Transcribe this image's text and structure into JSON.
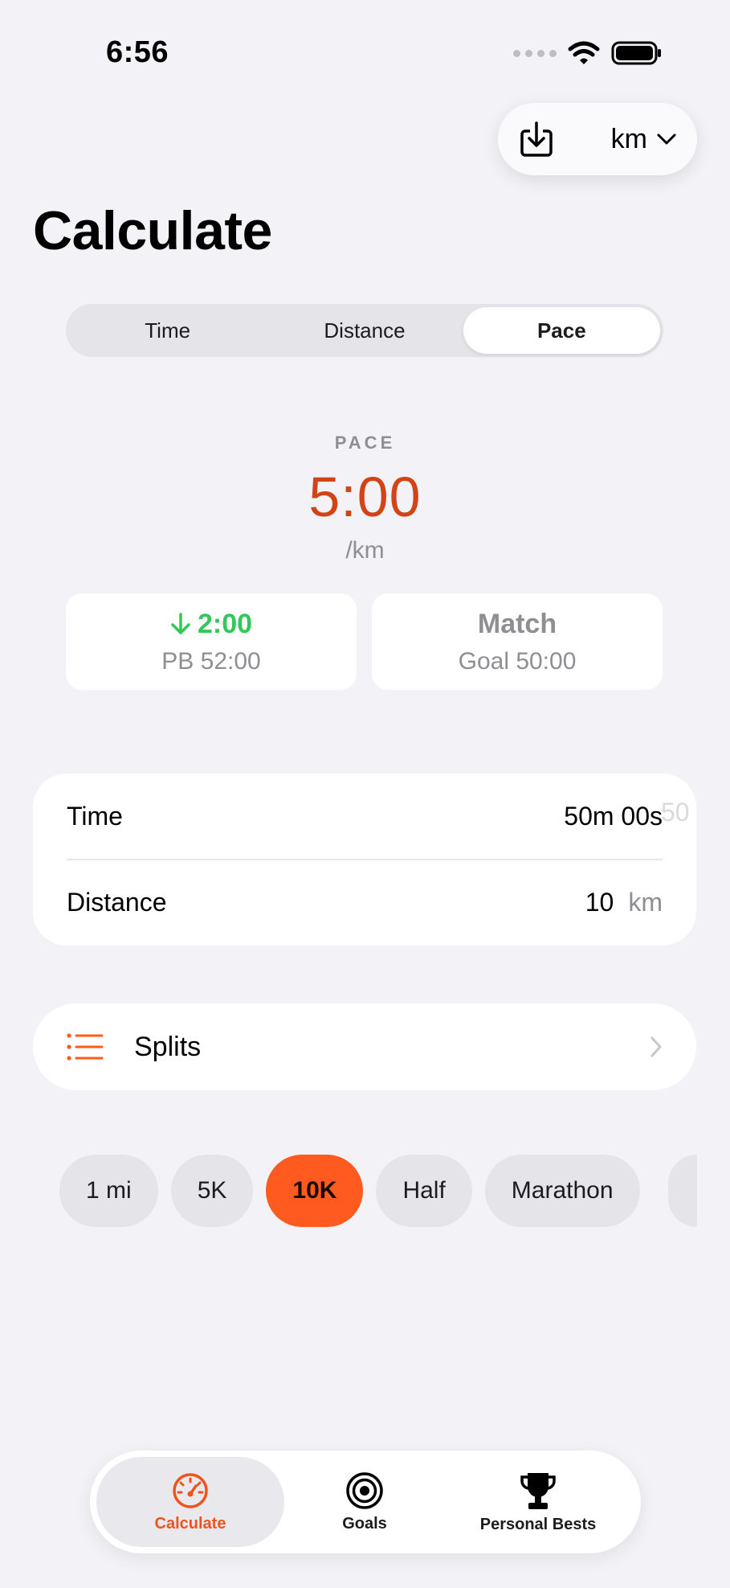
{
  "status_bar": {
    "time": "6:56"
  },
  "toolbar": {
    "unit": "km"
  },
  "page": {
    "title": "Calculate"
  },
  "segments": [
    {
      "label": "Time",
      "active": false
    },
    {
      "label": "Distance",
      "active": false
    },
    {
      "label": "Pace",
      "active": true
    }
  ],
  "result": {
    "label": "PACE",
    "value": "5:00",
    "unit": "/km"
  },
  "comparisons": {
    "pb": {
      "main": "2:00",
      "sub": "PB 52:00",
      "color": "#34C759"
    },
    "goal": {
      "main": "Match",
      "sub": "Goal 50:00"
    }
  },
  "inputs": {
    "time": {
      "label": "Time",
      "value": "50m 00s",
      "ghost": "50"
    },
    "distance": {
      "label": "Distance",
      "value": "10",
      "unit": "km"
    }
  },
  "splits": {
    "label": "Splits"
  },
  "presets": [
    {
      "label": "1 mi",
      "active": false
    },
    {
      "label": "5K",
      "active": false
    },
    {
      "label": "10K",
      "active": true
    },
    {
      "label": "Half",
      "active": false
    },
    {
      "label": "Marathon",
      "active": false
    }
  ],
  "tabs": [
    {
      "label": "Calculate",
      "icon": "speedometer-icon",
      "active": true
    },
    {
      "label": "Goals",
      "icon": "target-icon",
      "active": false
    },
    {
      "label": "Personal Bests",
      "icon": "trophy-icon",
      "active": false
    }
  ],
  "colors": {
    "accent": "#FF5A1F",
    "result": "#D24317",
    "positive": "#34C759",
    "background": "#F2F2F7"
  }
}
